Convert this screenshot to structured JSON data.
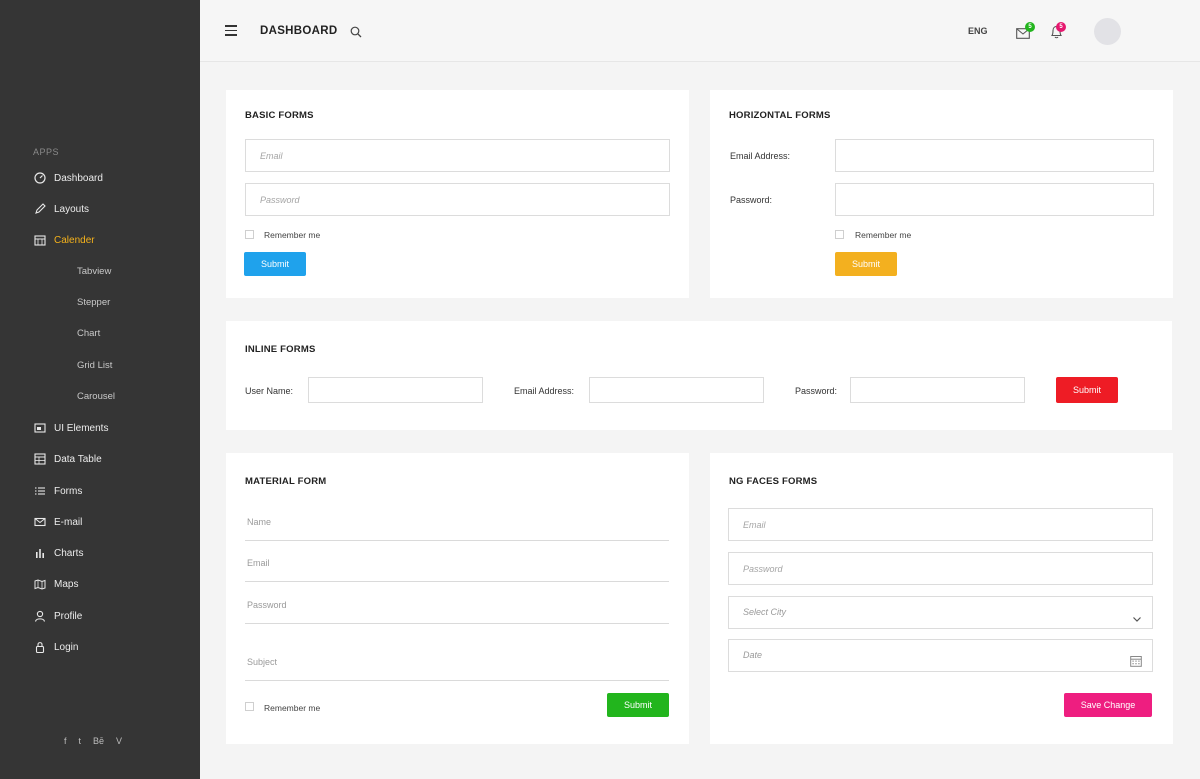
{
  "sidebar": {
    "section_label": "APPS",
    "items": [
      {
        "label": "Dashboard",
        "icon": "dashboard-icon"
      },
      {
        "label": "Layouts",
        "icon": "pen-icon"
      },
      {
        "label": "Calender",
        "icon": "calendar-icon",
        "active": true
      },
      {
        "label": "UI Elements",
        "icon": "ui-elements-icon"
      },
      {
        "label": "Data Table",
        "icon": "table-icon"
      },
      {
        "label": "Forms",
        "icon": "list-icon"
      },
      {
        "label": "E-mail",
        "icon": "mail-icon"
      },
      {
        "label": "Charts",
        "icon": "bar-chart-icon"
      },
      {
        "label": "Maps",
        "icon": "map-icon"
      },
      {
        "label": "Profile",
        "icon": "user-icon"
      },
      {
        "label": "Login",
        "icon": "lock-icon"
      }
    ],
    "subitems": [
      "Tabview",
      "Stepper",
      "Chart",
      "Grid List",
      "Carousel"
    ],
    "social": [
      "f",
      "t",
      "Bē",
      "V"
    ]
  },
  "header": {
    "title": "DASHBOARD",
    "lang": "ENG",
    "mail_count": "5",
    "notif_count": "5"
  },
  "basic_forms": {
    "title": "BASIC FORMS",
    "email_placeholder": "Email",
    "password_placeholder": "Password",
    "remember": "Remember me",
    "submit": "Submit"
  },
  "horizontal_forms": {
    "title": "HORIZONTAL FORMS",
    "email_label": "Email Address:",
    "password_label": "Password:",
    "remember": "Remember me",
    "submit": "Submit"
  },
  "inline_forms": {
    "title": "INLINE FORMS",
    "username_label": "User Name:",
    "email_label": "Email Address:",
    "password_label": "Password:",
    "submit": "Submit"
  },
  "material_form": {
    "title": "MATERIAL FORM",
    "name": "Name",
    "email": "Email",
    "password": "Password",
    "subject": "Subject",
    "remember": "Remember me",
    "submit": "Submit"
  },
  "ng_faces_forms": {
    "title": "NG FACES FORMS",
    "email_placeholder": "Email",
    "password_placeholder": "Password",
    "city_placeholder": "Select City",
    "date_placeholder": "Date",
    "save": "Save Change"
  },
  "colors": {
    "sidebar_bg": "#353535",
    "active": "#f5b21b",
    "blue": "#1fa2ec",
    "yellow": "#f3b01f",
    "red": "#ee1c25",
    "green": "#22b51d",
    "pink": "#ee1e80"
  }
}
